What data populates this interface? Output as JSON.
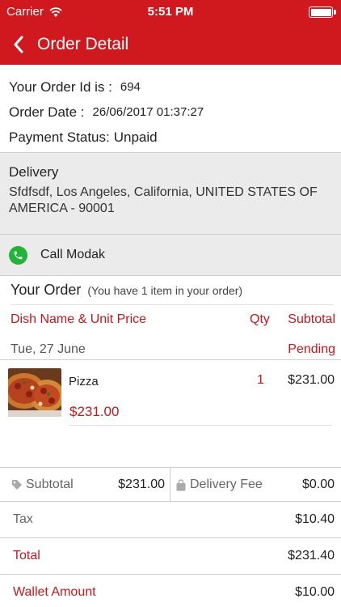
{
  "status_bar": {
    "carrier": "Carrier",
    "time": "5:51 PM"
  },
  "nav": {
    "title": "Order Detail"
  },
  "order": {
    "id_label": "Your Order Id is :",
    "id_value": "694",
    "date_label": "Order Date :",
    "date_value": "26/06/2017 01:37:27",
    "payment_label": "Payment Status:",
    "payment_value": "Unpaid"
  },
  "delivery": {
    "title": "Delivery",
    "address": "Sfdfsdf, Los Angeles, California, UNITED STATES OF AMERICA  - 90001"
  },
  "call": {
    "label": "Call Modak"
  },
  "your_order": {
    "title": "Your Order",
    "note": "(You have 1 item in your order)",
    "col_dish": "Dish Name & Unit Price",
    "col_qty": "Qty",
    "col_subtotal": "Subtotal",
    "date": "Tue, 27 June",
    "status": "Pending",
    "items": [
      {
        "name": "Pizza",
        "price": "$231.00",
        "qty": "1",
        "subtotal": "$231.00"
      }
    ]
  },
  "summary": {
    "subtotal_label": "Subtotal",
    "subtotal_value": "$231.00",
    "delivery_fee_label": "Delivery Fee",
    "delivery_fee_value": "$0.00",
    "tax_label": "Tax",
    "tax_value": "$10.40",
    "total_label": "Total",
    "total_value": "$231.40",
    "wallet_label": "Wallet Amount",
    "wallet_value": "$10.00"
  },
  "colors": {
    "brand_red": "#d0191e",
    "call_green": "#21b33a"
  },
  "icons": [
    "wifi-icon",
    "battery-icon",
    "back-chevron-icon",
    "phone-icon",
    "pizza-image",
    "tag-icon",
    "bag-icon"
  ]
}
